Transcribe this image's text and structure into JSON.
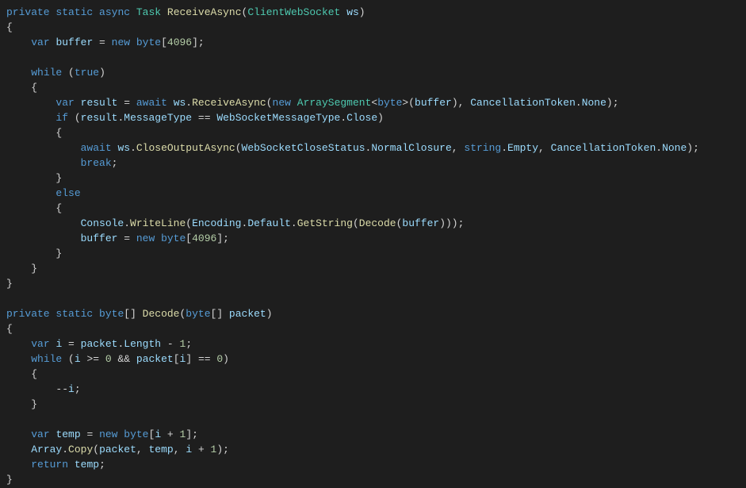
{
  "code": {
    "tokens": [
      [
        [
          "kw",
          "private"
        ],
        [
          "pun",
          " "
        ],
        [
          "kw",
          "static"
        ],
        [
          "pun",
          " "
        ],
        [
          "kw",
          "async"
        ],
        [
          "pun",
          " "
        ],
        [
          "typ",
          "Task"
        ],
        [
          "pun",
          " "
        ],
        [
          "fn",
          "ReceiveAsync"
        ],
        [
          "pun",
          "("
        ],
        [
          "typ",
          "ClientWebSocket"
        ],
        [
          "pun",
          " "
        ],
        [
          "id",
          "ws"
        ],
        [
          "pun",
          ")"
        ]
      ],
      [
        [
          "pun",
          "{"
        ]
      ],
      [
        [
          "pun",
          "    "
        ],
        [
          "kw",
          "var"
        ],
        [
          "pun",
          " "
        ],
        [
          "id",
          "buffer"
        ],
        [
          "pun",
          " = "
        ],
        [
          "kw",
          "new"
        ],
        [
          "pun",
          " "
        ],
        [
          "kw",
          "byte"
        ],
        [
          "pun",
          "["
        ],
        [
          "num",
          "4096"
        ],
        [
          "pun",
          "];"
        ]
      ],
      [],
      [
        [
          "pun",
          "    "
        ],
        [
          "cfw",
          "while"
        ],
        [
          "pun",
          " ("
        ],
        [
          "kw",
          "true"
        ],
        [
          "pun",
          ")"
        ]
      ],
      [
        [
          "pun",
          "    {"
        ]
      ],
      [
        [
          "pun",
          "        "
        ],
        [
          "kw",
          "var"
        ],
        [
          "pun",
          " "
        ],
        [
          "id",
          "result"
        ],
        [
          "pun",
          " = "
        ],
        [
          "cfw",
          "await"
        ],
        [
          "pun",
          " "
        ],
        [
          "id",
          "ws"
        ],
        [
          "pun",
          "."
        ],
        [
          "fn",
          "ReceiveAsync"
        ],
        [
          "pun",
          "("
        ],
        [
          "kw",
          "new"
        ],
        [
          "pun",
          " "
        ],
        [
          "typ",
          "ArraySegment"
        ],
        [
          "pun",
          "<"
        ],
        [
          "kw",
          "byte"
        ],
        [
          "pun",
          ">("
        ],
        [
          "id",
          "buffer"
        ],
        [
          "pun",
          "), "
        ],
        [
          "id",
          "CancellationToken"
        ],
        [
          "pun",
          "."
        ],
        [
          "id",
          "None"
        ],
        [
          "pun",
          ");"
        ]
      ],
      [
        [
          "pun",
          "        "
        ],
        [
          "cfw",
          "if"
        ],
        [
          "pun",
          " ("
        ],
        [
          "id",
          "result"
        ],
        [
          "pun",
          "."
        ],
        [
          "id",
          "MessageType"
        ],
        [
          "pun",
          " == "
        ],
        [
          "id",
          "WebSocketMessageType"
        ],
        [
          "pun",
          "."
        ],
        [
          "id",
          "Close"
        ],
        [
          "pun",
          ")"
        ]
      ],
      [
        [
          "pun",
          "        {"
        ]
      ],
      [
        [
          "pun",
          "            "
        ],
        [
          "cfw",
          "await"
        ],
        [
          "pun",
          " "
        ],
        [
          "id",
          "ws"
        ],
        [
          "pun",
          "."
        ],
        [
          "fn",
          "CloseOutputAsync"
        ],
        [
          "pun",
          "("
        ],
        [
          "id",
          "WebSocketCloseStatus"
        ],
        [
          "pun",
          "."
        ],
        [
          "id",
          "NormalClosure"
        ],
        [
          "pun",
          ", "
        ],
        [
          "kw",
          "string"
        ],
        [
          "pun",
          "."
        ],
        [
          "id",
          "Empty"
        ],
        [
          "pun",
          ", "
        ],
        [
          "id",
          "CancellationToken"
        ],
        [
          "pun",
          "."
        ],
        [
          "id",
          "None"
        ],
        [
          "pun",
          ");"
        ]
      ],
      [
        [
          "pun",
          "            "
        ],
        [
          "cfw",
          "break"
        ],
        [
          "pun",
          ";"
        ]
      ],
      [
        [
          "pun",
          "        }"
        ]
      ],
      [
        [
          "pun",
          "        "
        ],
        [
          "cfw",
          "else"
        ]
      ],
      [
        [
          "pun",
          "        {"
        ]
      ],
      [
        [
          "pun",
          "            "
        ],
        [
          "id",
          "Console"
        ],
        [
          "pun",
          "."
        ],
        [
          "fn",
          "WriteLine"
        ],
        [
          "pun",
          "("
        ],
        [
          "id",
          "Encoding"
        ],
        [
          "pun",
          "."
        ],
        [
          "id",
          "Default"
        ],
        [
          "pun",
          "."
        ],
        [
          "fn",
          "GetString"
        ],
        [
          "pun",
          "("
        ],
        [
          "fn",
          "Decode"
        ],
        [
          "pun",
          "("
        ],
        [
          "id",
          "buffer"
        ],
        [
          "pun",
          ")));"
        ]
      ],
      [
        [
          "pun",
          "            "
        ],
        [
          "id",
          "buffer"
        ],
        [
          "pun",
          " = "
        ],
        [
          "kw",
          "new"
        ],
        [
          "pun",
          " "
        ],
        [
          "kw",
          "byte"
        ],
        [
          "pun",
          "["
        ],
        [
          "num",
          "4096"
        ],
        [
          "pun",
          "];"
        ]
      ],
      [
        [
          "pun",
          "        }"
        ]
      ],
      [
        [
          "pun",
          "    }"
        ]
      ],
      [
        [
          "pun",
          "}"
        ]
      ],
      [],
      [
        [
          "kw",
          "private"
        ],
        [
          "pun",
          " "
        ],
        [
          "kw",
          "static"
        ],
        [
          "pun",
          " "
        ],
        [
          "kw",
          "byte"
        ],
        [
          "pun",
          "[] "
        ],
        [
          "fn",
          "Decode"
        ],
        [
          "pun",
          "("
        ],
        [
          "kw",
          "byte"
        ],
        [
          "pun",
          "[] "
        ],
        [
          "id",
          "packet"
        ],
        [
          "pun",
          ")"
        ]
      ],
      [
        [
          "pun",
          "{"
        ]
      ],
      [
        [
          "pun",
          "    "
        ],
        [
          "kw",
          "var"
        ],
        [
          "pun",
          " "
        ],
        [
          "id",
          "i"
        ],
        [
          "pun",
          " = "
        ],
        [
          "id",
          "packet"
        ],
        [
          "pun",
          "."
        ],
        [
          "id",
          "Length"
        ],
        [
          "pun",
          " - "
        ],
        [
          "num",
          "1"
        ],
        [
          "pun",
          ";"
        ]
      ],
      [
        [
          "pun",
          "    "
        ],
        [
          "cfw",
          "while"
        ],
        [
          "pun",
          " ("
        ],
        [
          "id",
          "i"
        ],
        [
          "pun",
          " >= "
        ],
        [
          "num",
          "0"
        ],
        [
          "pun",
          " && "
        ],
        [
          "id",
          "packet"
        ],
        [
          "pun",
          "["
        ],
        [
          "id",
          "i"
        ],
        [
          "pun",
          "] == "
        ],
        [
          "num",
          "0"
        ],
        [
          "pun",
          ")"
        ]
      ],
      [
        [
          "pun",
          "    {"
        ]
      ],
      [
        [
          "pun",
          "        --"
        ],
        [
          "id",
          "i"
        ],
        [
          "pun",
          ";"
        ]
      ],
      [
        [
          "pun",
          "    }"
        ]
      ],
      [],
      [
        [
          "pun",
          "    "
        ],
        [
          "kw",
          "var"
        ],
        [
          "pun",
          " "
        ],
        [
          "id",
          "temp"
        ],
        [
          "pun",
          " = "
        ],
        [
          "kw",
          "new"
        ],
        [
          "pun",
          " "
        ],
        [
          "kw",
          "byte"
        ],
        [
          "pun",
          "["
        ],
        [
          "id",
          "i"
        ],
        [
          "pun",
          " + "
        ],
        [
          "num",
          "1"
        ],
        [
          "pun",
          "];"
        ]
      ],
      [
        [
          "pun",
          "    "
        ],
        [
          "id",
          "Array"
        ],
        [
          "pun",
          "."
        ],
        [
          "fn",
          "Copy"
        ],
        [
          "pun",
          "("
        ],
        [
          "id",
          "packet"
        ],
        [
          "pun",
          ", "
        ],
        [
          "id",
          "temp"
        ],
        [
          "pun",
          ", "
        ],
        [
          "id",
          "i"
        ],
        [
          "pun",
          " + "
        ],
        [
          "num",
          "1"
        ],
        [
          "pun",
          ");"
        ]
      ],
      [
        [
          "pun",
          "    "
        ],
        [
          "cfw",
          "return"
        ],
        [
          "pun",
          " "
        ],
        [
          "id",
          "temp"
        ],
        [
          "pun",
          ";"
        ]
      ],
      [
        [
          "pun",
          "}"
        ]
      ]
    ]
  },
  "controlFlowColor": "#569cd6"
}
